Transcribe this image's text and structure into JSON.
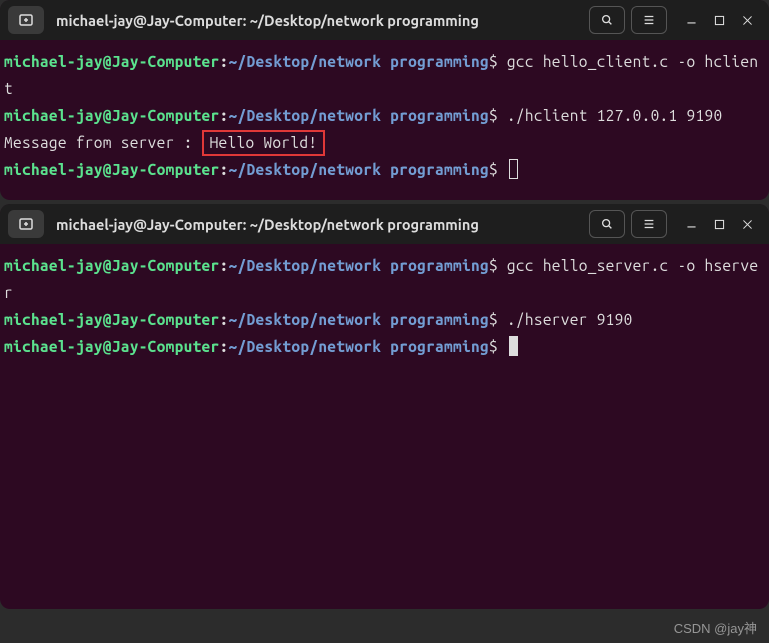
{
  "terminal1": {
    "title": "michael-jay@Jay-Computer: ~/Desktop/network programming",
    "prompt": {
      "user_host": "michael-jay@Jay-Computer",
      "colon": ":",
      "path": "~/Desktop/network programming",
      "dollar": "$"
    },
    "cmd1": " gcc hello_client.c -o hclient",
    "output_prefix": "Message from server : ",
    "output_highlight": "Hello World!",
    "cmd2": " ./hclient 127.0.0.1 9190"
  },
  "terminal2": {
    "title": "michael-jay@Jay-Computer: ~/Desktop/network programming",
    "prompt": {
      "user_host": "michael-jay@Jay-Computer",
      "colon": ":",
      "path": "~/Desktop/network programming",
      "dollar": "$"
    },
    "cmd1": " gcc hello_server.c -o hserver",
    "cmd2": " ./hserver 9190"
  },
  "watermark": "CSDN @jay神"
}
